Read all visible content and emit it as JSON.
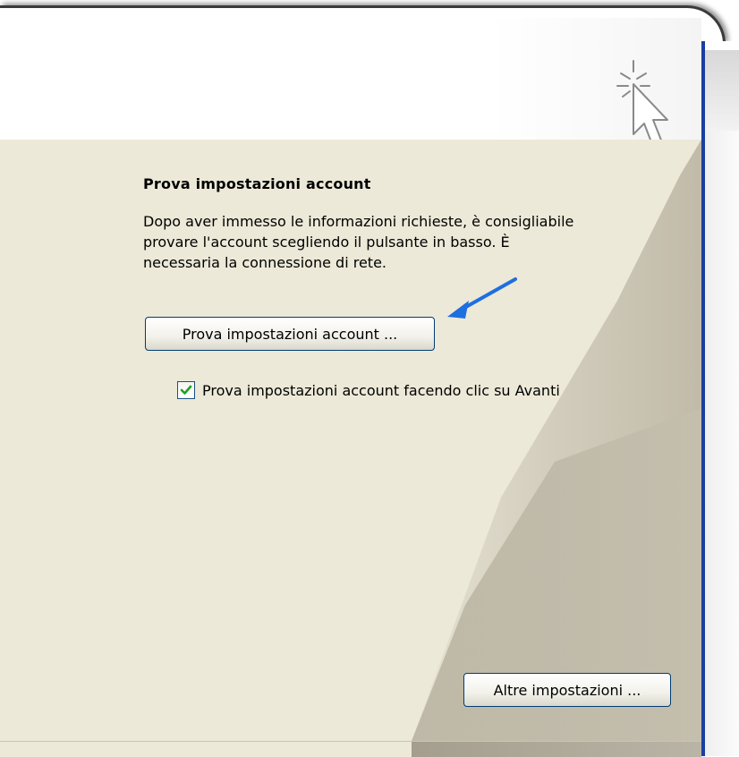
{
  "section": {
    "title": "Prova impostazioni account",
    "description_lines": [
      "Dopo aver immesso le informazioni richieste, è consigliabile",
      "provare l'account scegliendo il pulsante in basso. È",
      "necessaria la connessione di rete."
    ]
  },
  "buttons": {
    "test_account": "Prova impostazioni account ...",
    "more_settings": "Altre impostazioni ..."
  },
  "checkbox": {
    "label": "Prova impostazioni account facendo clic su Avanti",
    "checked": true
  },
  "icons": {
    "header": "click-cursor-icon",
    "annotation": "arrow-pointer-annotation",
    "check": "checkmark-icon"
  },
  "colors": {
    "dialog_bg": "#ece9d8",
    "accent_blue": "#1b3fa0",
    "annotation_arrow": "#1e6fe0",
    "check_green": "#21a121"
  }
}
